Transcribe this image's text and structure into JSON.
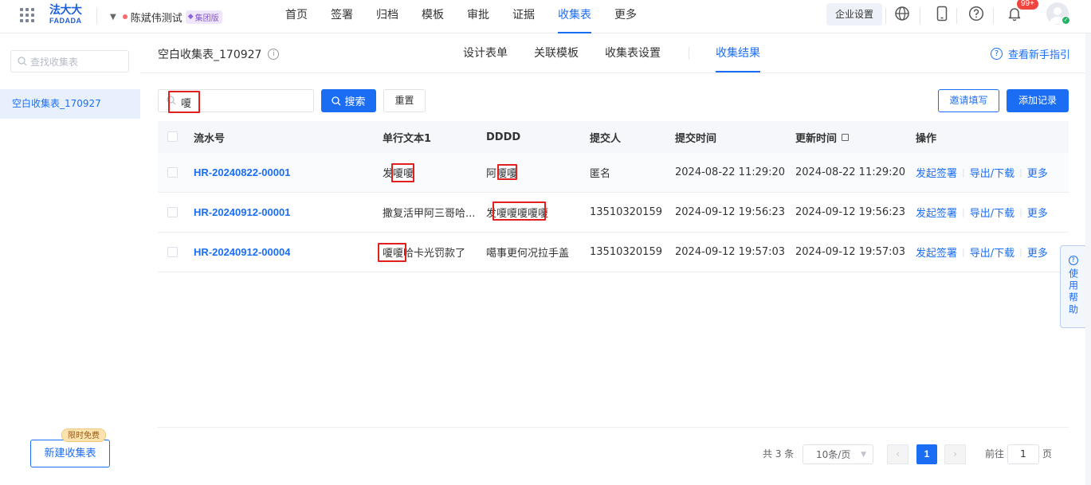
{
  "app": {
    "logo_cn": "法大大",
    "logo_en": "FADADA",
    "org_name": "陈斌伟测试",
    "org_badge": "集团版"
  },
  "nav": {
    "items": [
      "首页",
      "签署",
      "归档",
      "模板",
      "审批",
      "证据",
      "收集表",
      "更多"
    ],
    "active": "收集表",
    "enterprise_settings": "企业设置",
    "notification_count": "99+"
  },
  "sidebar": {
    "search_placeholder": "查找收集表",
    "items": [
      "空白收集表_170927"
    ],
    "free_tag": "限时免费",
    "new_button": "新建收集表"
  },
  "page": {
    "title": "空白收集表_170927",
    "tabs": [
      "设计表单",
      "关联模板",
      "收集表设置",
      "收集结果"
    ],
    "active_tab": "收集结果",
    "guide_link": "查看新手指引"
  },
  "filter": {
    "search_value": "嗄",
    "search_button": "搜索",
    "reset_button": "重置",
    "invite_button": "邀请填写",
    "add_button": "添加记录"
  },
  "table": {
    "headers": [
      "流水号",
      "单行文本1",
      "DDDD",
      "提交人",
      "提交时间",
      "更新时间",
      "操作"
    ],
    "rows": [
      {
        "serial": "HR-20240822-00001",
        "text1": "发嗄嗄",
        "dddd": "阿嗄嗄",
        "submitter": "匿名",
        "submit_time": "2024-08-22 11:29:20",
        "update_time": "2024-08-22 11:29:20"
      },
      {
        "serial": "HR-20240912-00001",
        "text1": "撒复活甲阿三哥哈...",
        "dddd": "发嗄嗄嗄嗄嗄",
        "submitter": "13510320159",
        "submit_time": "2024-09-12 19:56:23",
        "update_time": "2024-09-12 19:56:23"
      },
      {
        "serial": "HR-20240912-00004",
        "text1": "嗄嗄哈卡光罚款了",
        "dddd": "噶事更何况拉手盖",
        "submitter": "13510320159",
        "submit_time": "2024-09-12 19:57:03",
        "update_time": "2024-09-12 19:57:03"
      }
    ],
    "actions": [
      "发起签署",
      "导出/下载",
      "更多"
    ]
  },
  "pagination": {
    "total": "共 3 条",
    "page_size": "10条/页",
    "current_page": "1",
    "goto_label": "前往",
    "goto_value": "1",
    "goto_suffix": "页"
  },
  "help": {
    "label": "使用帮助"
  },
  "colors": {
    "accent": "#1b6ef3",
    "highlight_box": "#e0201d",
    "badge_red": "#f0453e"
  }
}
